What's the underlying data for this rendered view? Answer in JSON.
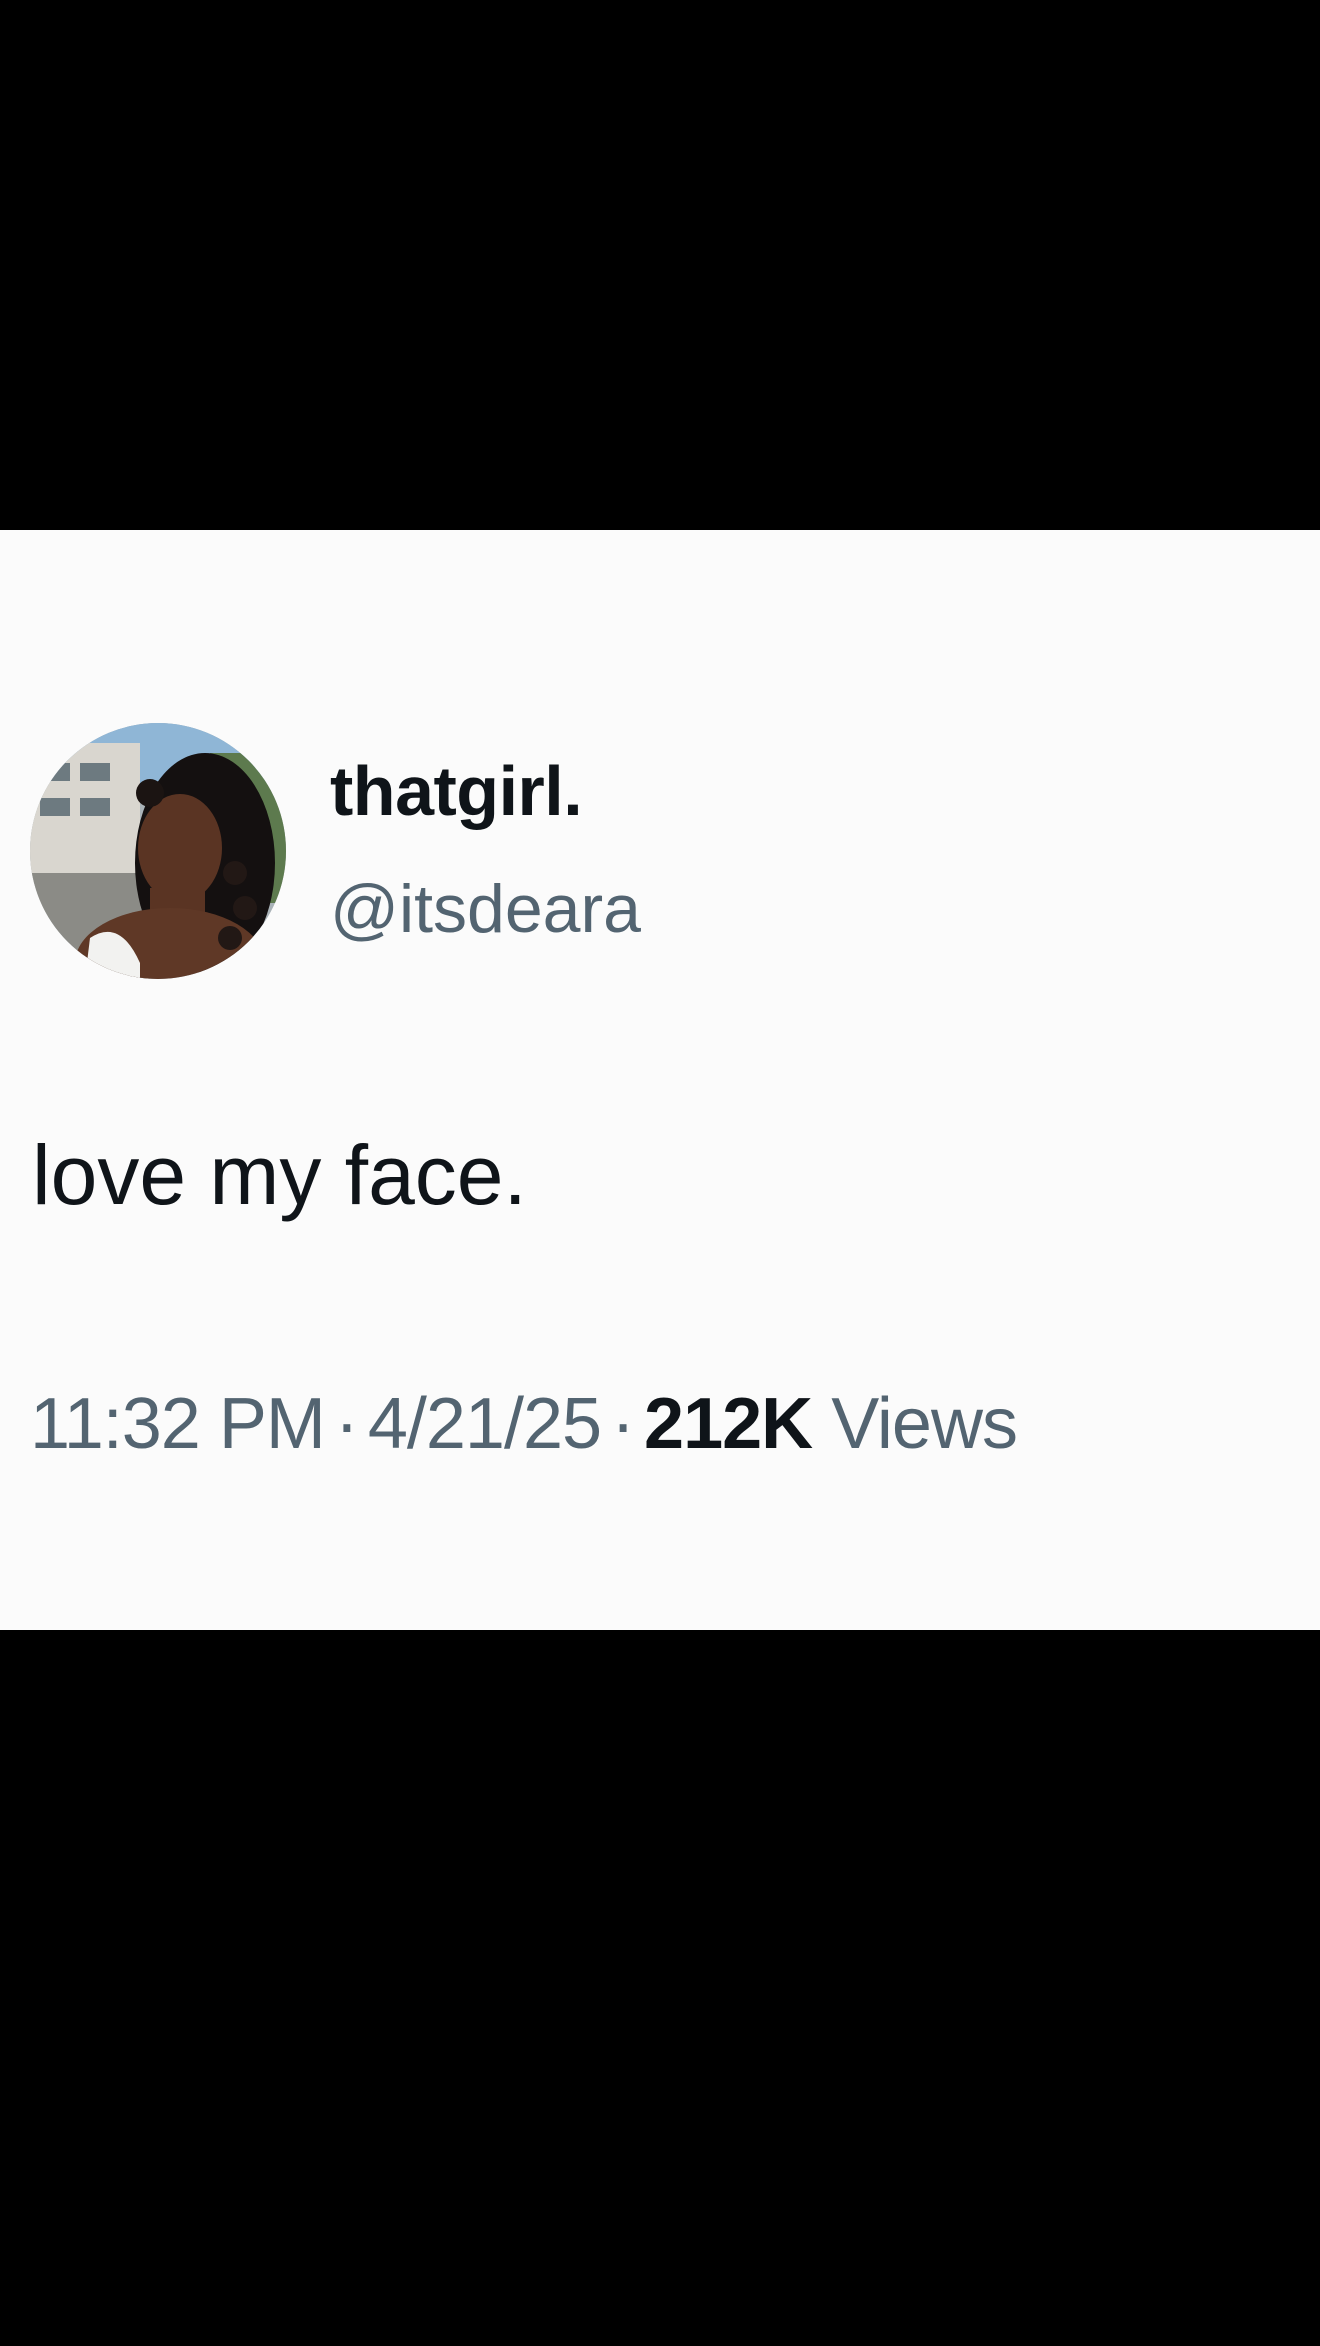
{
  "tweet": {
    "display_name": "thatgirl.",
    "handle": "@itsdeara",
    "text": "love my face.",
    "time": "11:32 PM",
    "separator": "·",
    "date": "4/21/25",
    "views_count": "212K",
    "views_label": "Views"
  },
  "colors": {
    "card_background": "#fbfbfb",
    "frame_background": "#000000",
    "primary_text": "#0f1419",
    "secondary_text": "#536471"
  },
  "icons": {
    "avatar": "profile-photo"
  }
}
